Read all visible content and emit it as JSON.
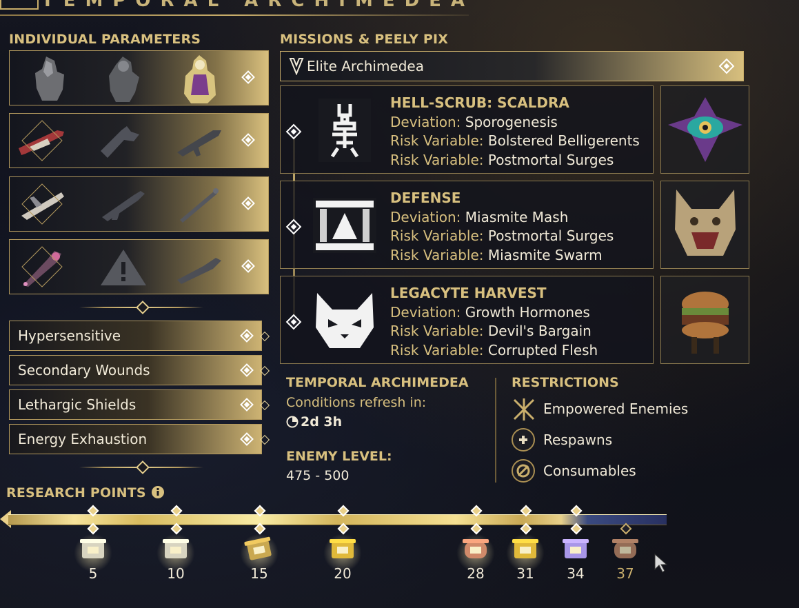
{
  "header": {
    "title": "TEMPORAL ARCHIMEDEA"
  },
  "individual_parameters": {
    "title": "INDIVIDUAL PARAMETERS",
    "rows": [
      {
        "name": "warframes",
        "slots": [
          "warframe-1",
          "warframe-2",
          "warframe-3-selected"
        ]
      },
      {
        "name": "primaries",
        "slots": [
          "primary-selected",
          "primary-2",
          "primary-3"
        ]
      },
      {
        "name": "secondaries",
        "slots": [
          "secondary-selected",
          "secondary-2",
          "secondary-3"
        ]
      },
      {
        "name": "melees",
        "slots": [
          "melee-selected",
          "melee-warning",
          "melee-3"
        ]
      }
    ],
    "modifiers": [
      "Hypersensitive",
      "Secondary Wounds",
      "Lethargic Shields",
      "Energy Exhaustion"
    ]
  },
  "missions": {
    "title": "MISSIONS & PEELY PIX",
    "elite_label": "Elite Archimedea",
    "list": [
      {
        "name": "HELL-SCRUB: SCALDRA",
        "lines": [
          {
            "label": "Deviation:",
            "value": "Sporogenesis"
          },
          {
            "label": "Risk Variable:",
            "value": "Bolstered Belligerents"
          },
          {
            "label": "Risk Variable:",
            "value": "Postmortal Surges"
          }
        ]
      },
      {
        "name": "DEFENSE",
        "lines": [
          {
            "label": "Deviation:",
            "value": "Miasmite Mash"
          },
          {
            "label": "Risk Variable:",
            "value": "Postmortal Surges"
          },
          {
            "label": "Risk Variable:",
            "value": "Miasmite Swarm"
          }
        ]
      },
      {
        "name": "LEGACYTE HARVEST",
        "lines": [
          {
            "label": "Deviation:",
            "value": "Growth Hormones"
          },
          {
            "label": "Risk Variable:",
            "value": "Devil's Bargain"
          },
          {
            "label": "Risk Variable:",
            "value": "Corrupted Flesh"
          }
        ]
      }
    ]
  },
  "temporal": {
    "title": "TEMPORAL ARCHIMEDEA",
    "refresh_label": "Conditions refresh in:",
    "refresh_value": "2d 3h",
    "enemy_level_label": "ENEMY LEVEL:",
    "enemy_level_value": "475 - 500"
  },
  "restrictions": {
    "title": "RESTRICTIONS",
    "items": [
      "Empowered Enemies",
      "Respawns",
      "Consumables"
    ]
  },
  "research": {
    "title": "RESEARCH POINTS",
    "progress_points": 34,
    "rewards": [
      {
        "value": "5",
        "color": "#d8d4c0",
        "claimed": true
      },
      {
        "value": "10",
        "color": "#d8d4c0",
        "claimed": true
      },
      {
        "value": "15",
        "color": "#c9a850",
        "claimed": true
      },
      {
        "value": "20",
        "color": "#e0b93a",
        "claimed": true
      },
      {
        "value": "28",
        "color": "#d08a6a",
        "claimed": true
      },
      {
        "value": "31",
        "color": "#e0b93a",
        "claimed": true
      },
      {
        "value": "34",
        "color": "#a896e8",
        "claimed": true
      },
      {
        "value": "37",
        "color": "#c08a6a",
        "claimed": false
      }
    ]
  }
}
